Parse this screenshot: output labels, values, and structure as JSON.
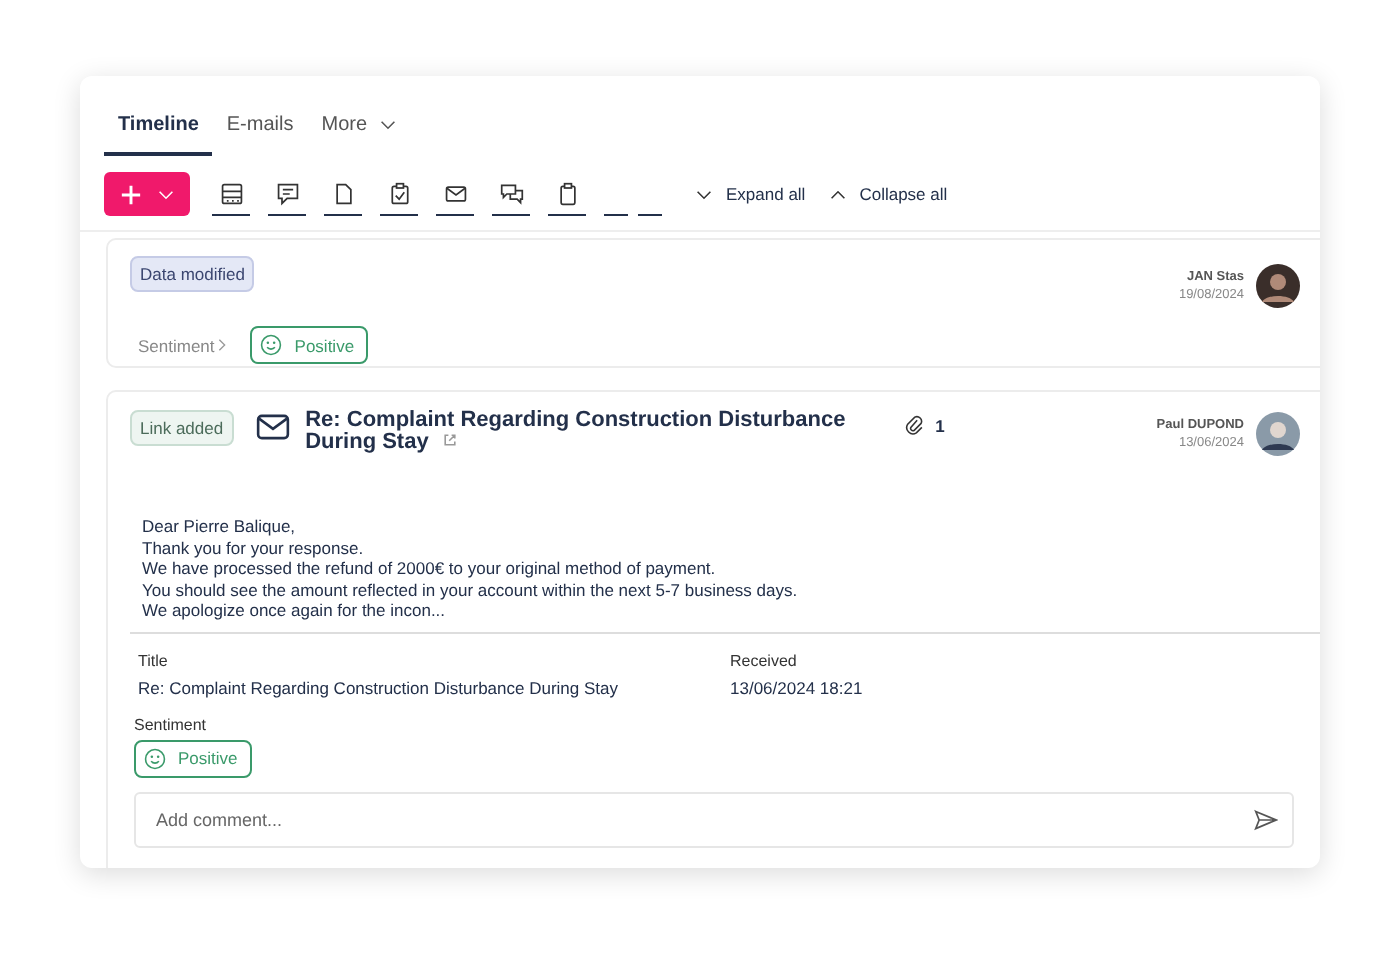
{
  "tabs": [
    {
      "label": "Timeline",
      "selected": true
    },
    {
      "label": "E-mails",
      "selected": false
    },
    {
      "label": "More",
      "selected": false,
      "kind": "dropdown"
    }
  ],
  "toolbar": {
    "tools": [
      {
        "kind": "display"
      },
      {
        "kind": "note"
      },
      {
        "kind": "file"
      },
      {
        "kind": "task"
      },
      {
        "kind": "mail"
      },
      {
        "kind": "chat"
      },
      {
        "kind": "clipboard"
      },
      {
        "kind": "blank"
      },
      {
        "kind": "blank"
      }
    ],
    "expand": "Expand all",
    "collapse": "Collapse all"
  },
  "entries": [
    {
      "kind": "data",
      "tag": "Data modified",
      "author": "JAN Stas",
      "date": "19/08/2024",
      "sentiment_label": "Sentiment",
      "sentiment": "Positive"
    },
    {
      "kind": "email",
      "tag": "Link added",
      "subject": "Re: Complaint Regarding Construction Disturbance During Stay",
      "attachments": "1",
      "author": "Paul DUPOND",
      "date": "13/06/2024",
      "body": [
        "Dear Pierre Balique,",
        "Thank you for your response.",
        "We have processed the refund of 2000€ to your original method of payment.",
        "You should see the amount reflected in your account within the next 5-7 business days.",
        "We apologize once again for the incon..."
      ],
      "fields": [
        {
          "label": "Title",
          "value": "Re: Complaint Regarding Construction Disturbance During Stay"
        },
        {
          "label": "Received",
          "value": "13/06/2024 18:21"
        }
      ],
      "sentiment_label": "Sentiment",
      "sentiment": "Positive",
      "comment_placeholder": "Add comment..."
    }
  ]
}
